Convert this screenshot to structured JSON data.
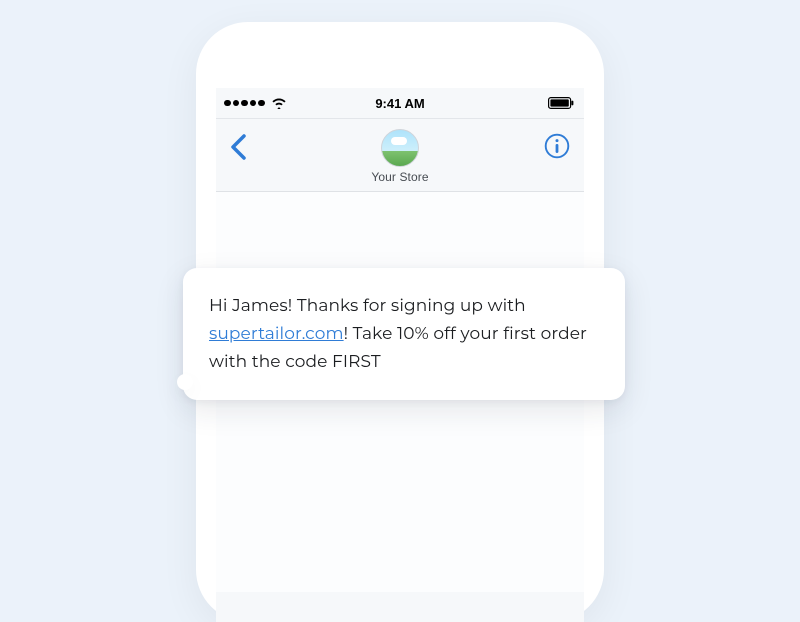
{
  "statusBar": {
    "time": "9:41 AM"
  },
  "header": {
    "contactName": "Your Store"
  },
  "message": {
    "part1": "Hi James! Thanks for signing up with ",
    "link": "supertailor.com",
    "part2": "! Take 10% off your first order with the code FIRST"
  }
}
